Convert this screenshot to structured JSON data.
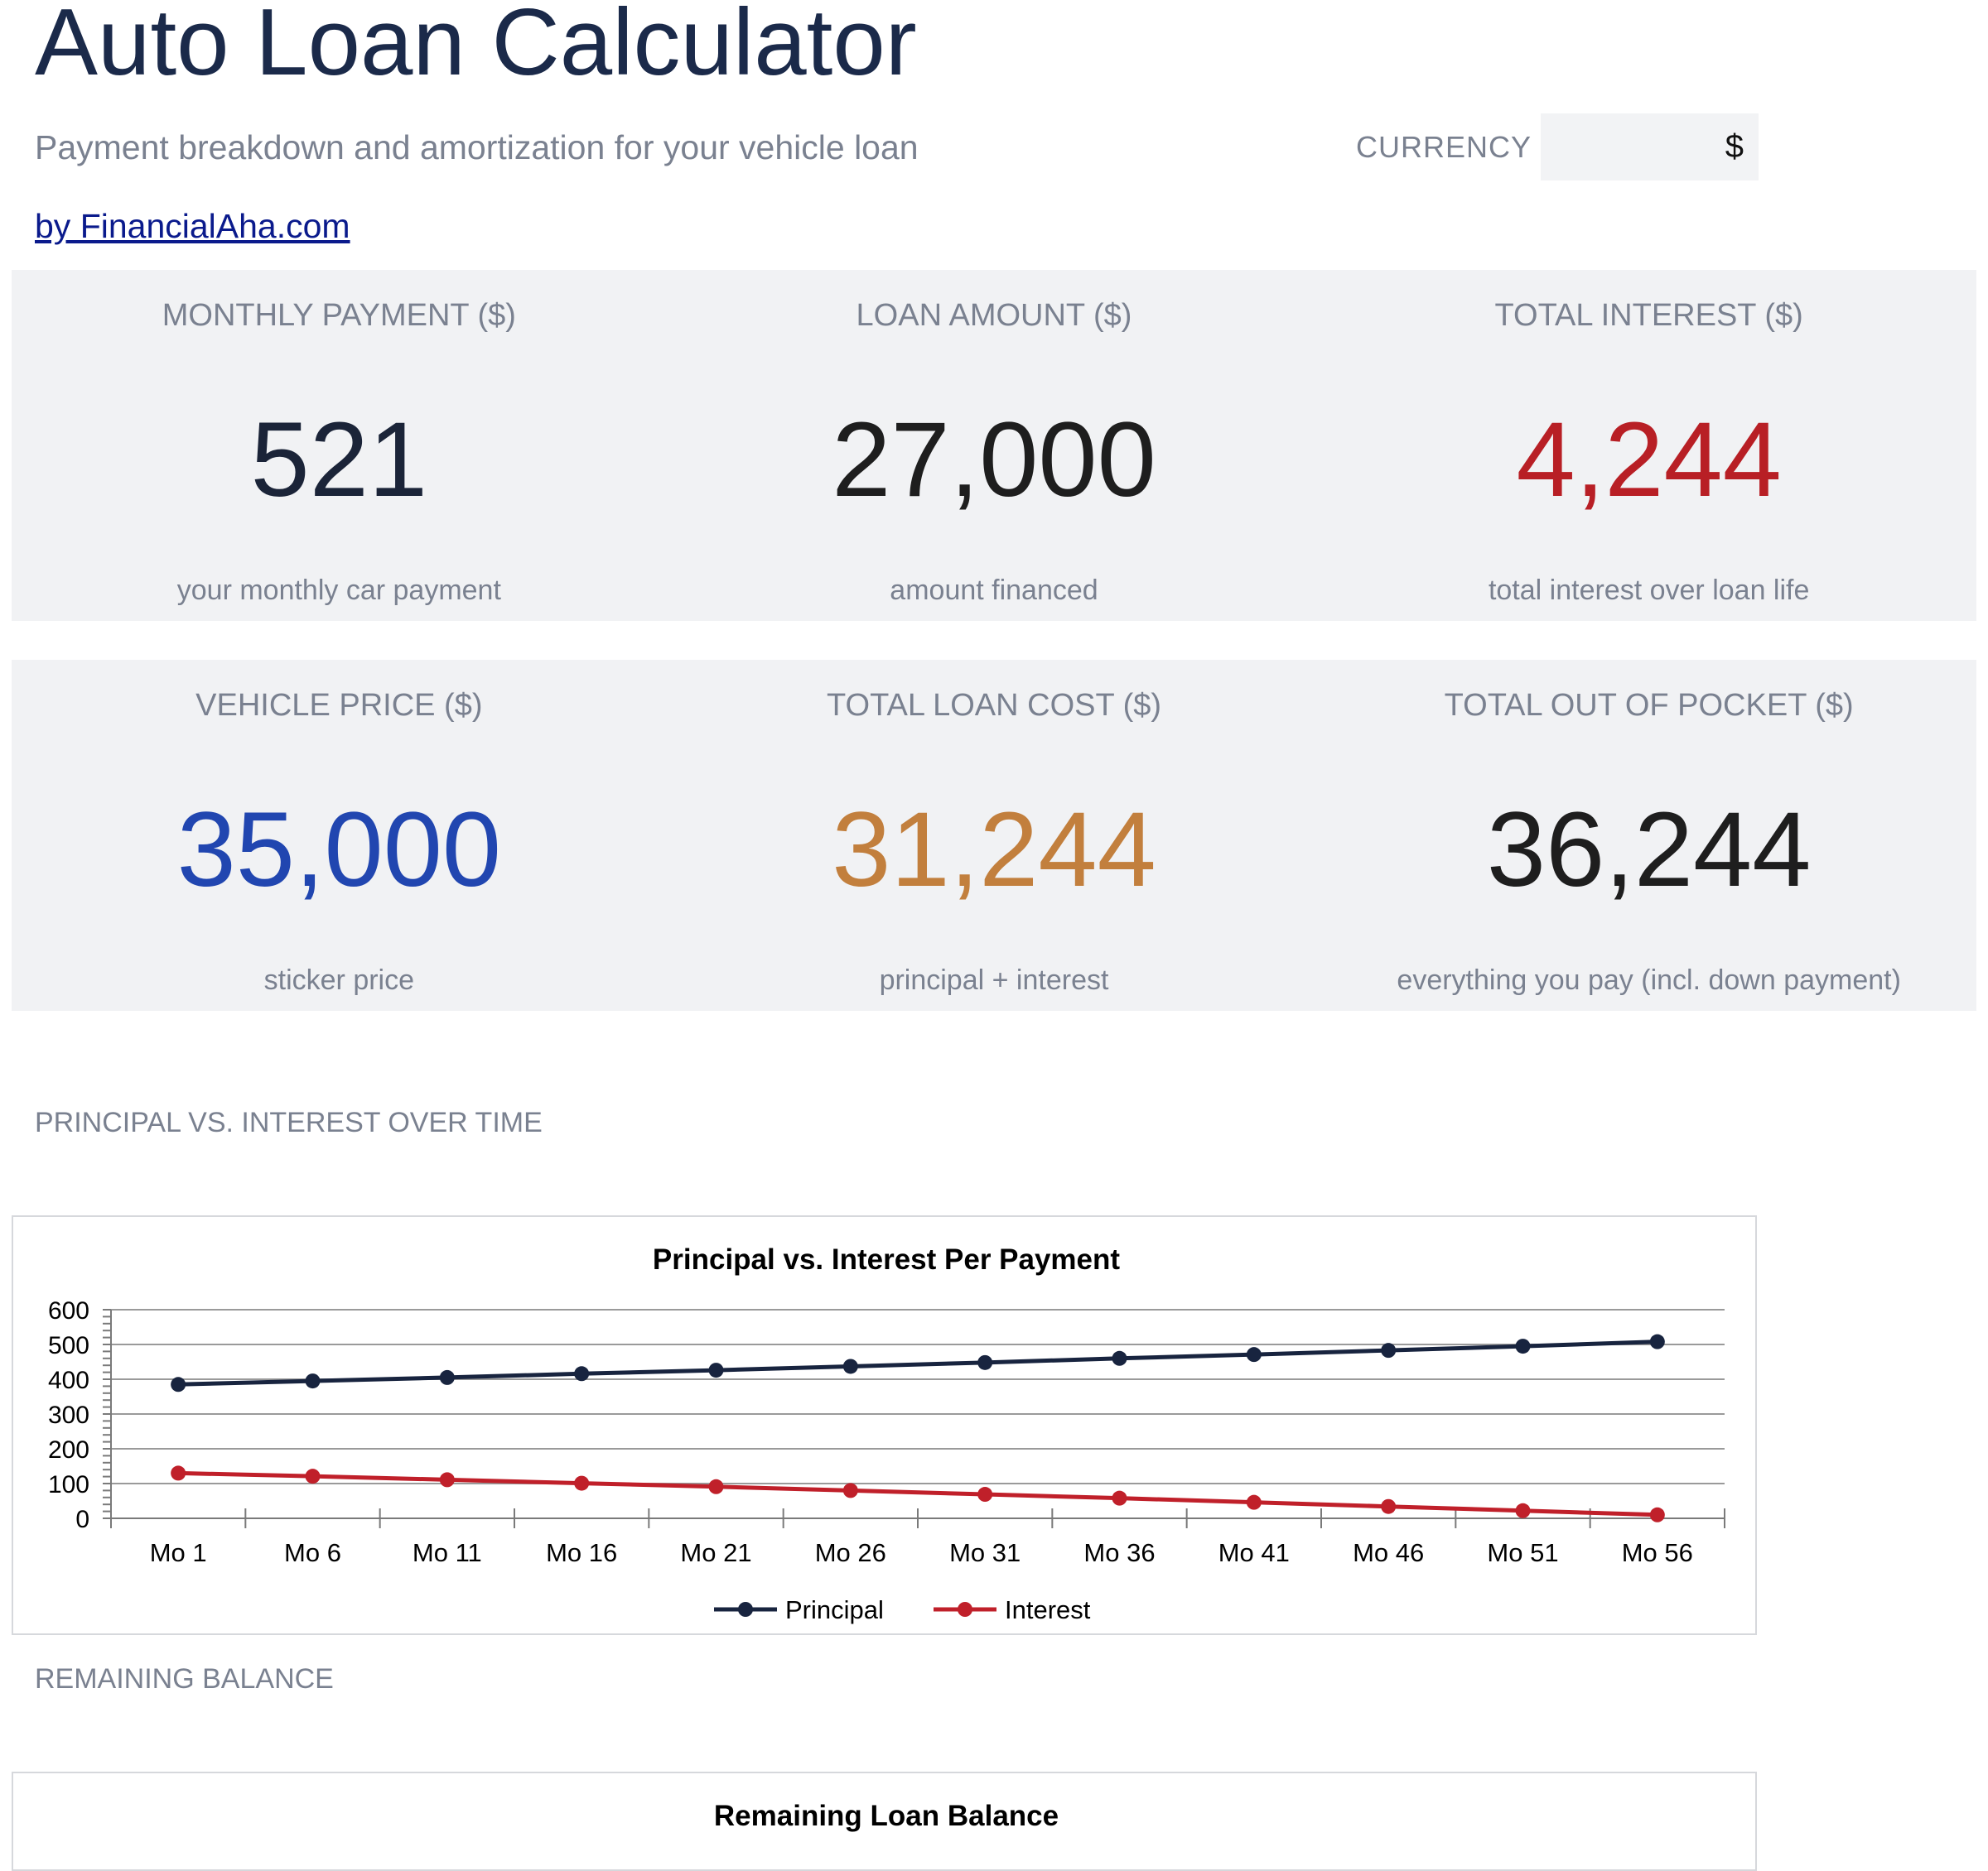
{
  "header": {
    "title": "Auto Loan Calculator",
    "subtitle": "Payment breakdown and amortization for your vehicle loan",
    "byline": "by FinancialAha.com",
    "currency_label": "CURRENCY",
    "currency_value": "$"
  },
  "summary_row_1": [
    {
      "label": "MONTHLY PAYMENT ($)",
      "value": "521",
      "note": "your monthly car payment",
      "color": "#1b2438"
    },
    {
      "label": "LOAN AMOUNT ($)",
      "value": "27,000",
      "note": "amount financed",
      "color": "#1e1e1e"
    },
    {
      "label": "TOTAL INTEREST ($)",
      "value": "4,244",
      "note": "total interest over loan life",
      "color": "#b81f25"
    }
  ],
  "summary_row_2": [
    {
      "label": "VEHICLE PRICE ($)",
      "value": "35,000",
      "note": "sticker price",
      "color": "#2146b0"
    },
    {
      "label": "TOTAL LOAN COST ($)",
      "value": "31,244",
      "note": "principal + interest",
      "color": "#c27f3d"
    },
    {
      "label": "TOTAL OUT OF POCKET ($)",
      "value": "36,244",
      "note": "everything you pay (incl. down payment)",
      "color": "#1e1e1e"
    }
  ],
  "sections": {
    "principal_interest_heading": "PRINCIPAL VS. INTEREST OVER TIME",
    "remaining_balance_heading": "REMAINING BALANCE",
    "remaining_balance_chart_title": "Remaining Loan Balance"
  },
  "chart_data": {
    "type": "line",
    "title": "Principal vs. Interest Per Payment",
    "categories": [
      "Mo 1",
      "Mo 6",
      "Mo 11",
      "Mo 16",
      "Mo 21",
      "Mo 26",
      "Mo 31",
      "Mo 36",
      "Mo 41",
      "Mo 46",
      "Mo 51",
      "Mo 56"
    ],
    "y_ticks": [
      "600",
      "500",
      "400",
      "300",
      "200",
      "100",
      "0"
    ],
    "ylim": [
      0,
      600
    ],
    "grid": true,
    "legend_position": "bottom",
    "series": [
      {
        "name": "Principal",
        "color": "#18243f",
        "values": [
          385,
          395,
          405,
          416,
          426,
          437,
          448,
          460,
          471,
          483,
          495,
          508
        ]
      },
      {
        "name": "Interest",
        "color": "#c0202a",
        "values": [
          130,
          121,
          111,
          101,
          91,
          80,
          69,
          58,
          46,
          34,
          22,
          10
        ]
      }
    ]
  }
}
